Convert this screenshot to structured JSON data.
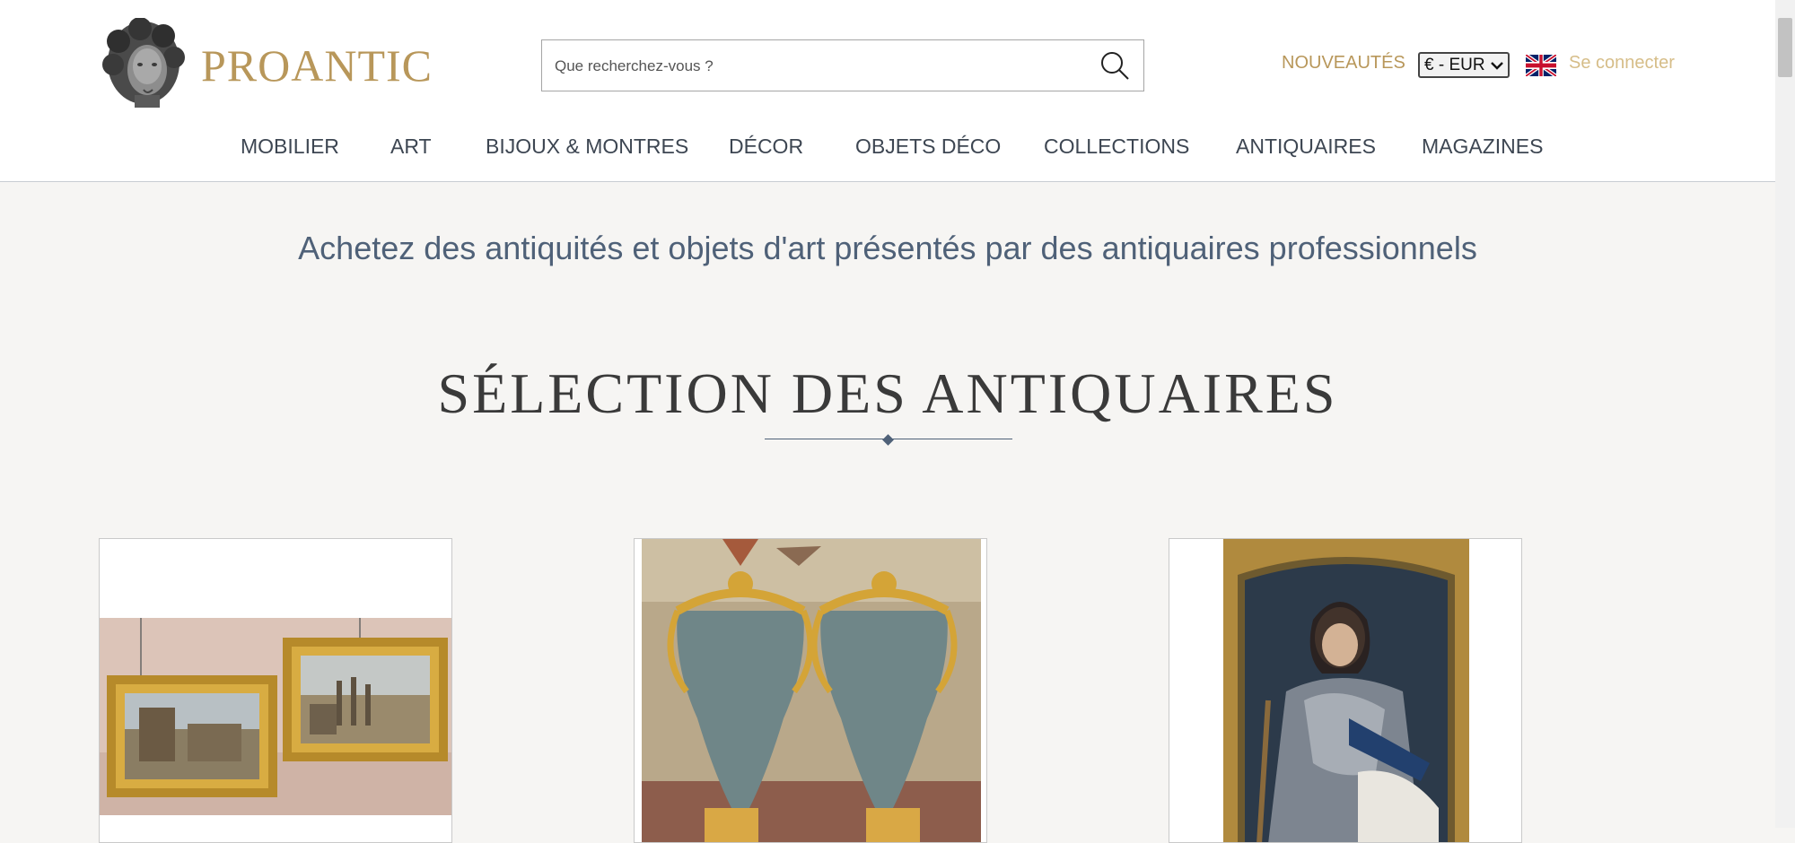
{
  "header": {
    "logo_text": "PROANTIC",
    "search": {
      "placeholder": "Que recherchez-vous ?"
    },
    "new_label": "NOUVEAUTÉS",
    "currency": "€ - EUR",
    "login_label": "Se connecter",
    "colors": {
      "brand_gold": "#b8975a",
      "login_gold": "#d6bd88",
      "nav_text": "#3d4652",
      "accent_blue": "#4f6178"
    }
  },
  "nav": {
    "items": [
      {
        "label": "MOBILIER"
      },
      {
        "label": "ART"
      },
      {
        "label": "BIJOUX & MONTRES"
      },
      {
        "label": "DÉCOR"
      },
      {
        "label": "OBJETS DÉCO"
      },
      {
        "label": "COLLECTIONS"
      },
      {
        "label": "ANTIQUAIRES"
      },
      {
        "label": "MAGAZINES"
      }
    ]
  },
  "main": {
    "tagline": "Achetez des antiquités et objets d'art présentés par des antiquaires professionnels",
    "section_title": "SÉLECTION DES ANTIQUAIRES",
    "cards": [
      {
        "image": "pair-of-framed-landscape-paintings"
      },
      {
        "image": "pair-of-gilt-bronze-marble-vases"
      },
      {
        "image": "framed-portrait-of-nobleman-in-armor"
      }
    ]
  }
}
